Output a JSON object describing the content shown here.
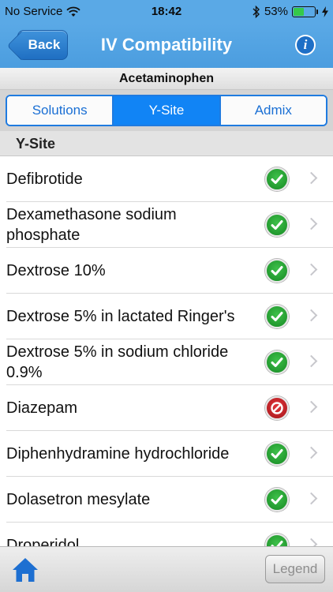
{
  "status_bar": {
    "carrier": "No Service",
    "time": "18:42",
    "battery": "53%",
    "battery_level": 0.53
  },
  "nav": {
    "back_label": "Back",
    "title": "IV Compatibility",
    "info_icon": "i"
  },
  "drug": {
    "name": "Acetaminophen"
  },
  "segments": [
    {
      "label": "Solutions",
      "active": false
    },
    {
      "label": "Y-Site",
      "active": true
    },
    {
      "label": "Admix",
      "active": false
    }
  ],
  "section": {
    "title": "Y-Site"
  },
  "items": [
    {
      "label": "Defibrotide",
      "status": "compatible"
    },
    {
      "label": "Dexamethasone sodium phosphate",
      "status": "compatible"
    },
    {
      "label": "Dextrose 10%",
      "status": "compatible"
    },
    {
      "label": "Dextrose 5% in lactated Ringer's",
      "status": "compatible"
    },
    {
      "label": "Dextrose 5% in sodium chloride 0.9%",
      "status": "compatible"
    },
    {
      "label": "Diazepam",
      "status": "incompatible"
    },
    {
      "label": "Diphenhydramine hydrochloride",
      "status": "compatible"
    },
    {
      "label": "Dolasetron mesylate",
      "status": "compatible"
    },
    {
      "label": "Droperidol",
      "status": "compatible"
    }
  ],
  "toolbar": {
    "legend_label": "Legend"
  },
  "colors": {
    "nav_blue": "#5aa9e6",
    "segment_active": "#1184f5",
    "compatible": "#2aa83a",
    "incompatible": "#c81f25"
  }
}
